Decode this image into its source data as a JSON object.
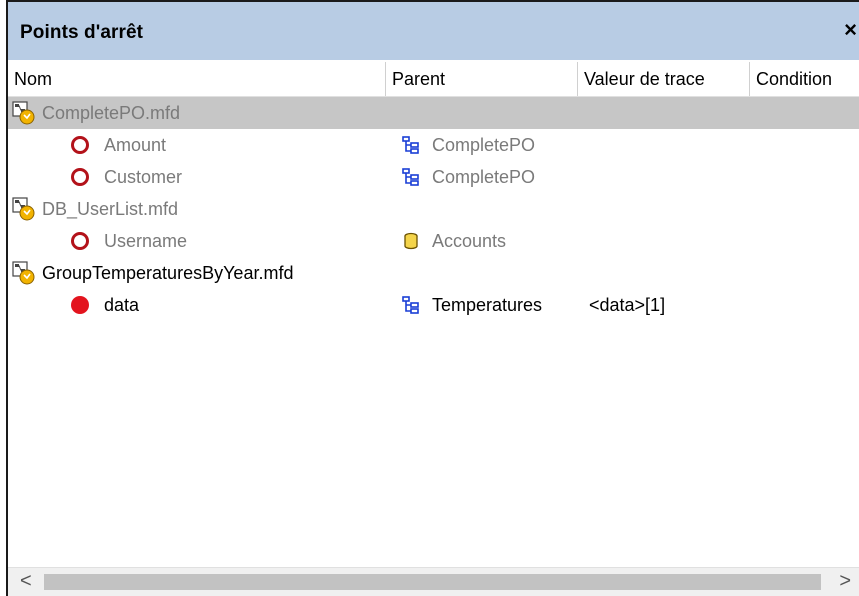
{
  "panel": {
    "title": "Points d'arrêt",
    "close_label": "×"
  },
  "columns": {
    "name": "Nom",
    "parent": "Parent",
    "trace_value": "Valeur de trace",
    "condition": "Condition"
  },
  "rows": [
    {
      "type": "file",
      "name": "CompletePO.mfd",
      "selected": true
    },
    {
      "type": "breakpoint",
      "name": "Amount",
      "parent": "CompletePO",
      "parent_icon": "schema-tree-icon",
      "enabled": false
    },
    {
      "type": "breakpoint",
      "name": "Customer",
      "parent": "CompletePO",
      "parent_icon": "schema-tree-icon",
      "enabled": false
    },
    {
      "type": "file",
      "name": "DB_UserList.mfd"
    },
    {
      "type": "breakpoint",
      "name": "Username",
      "parent": "Accounts",
      "parent_icon": "database-icon",
      "enabled": false
    },
    {
      "type": "file",
      "name": "GroupTemperaturesByYear.mfd"
    },
    {
      "type": "breakpoint",
      "name": "data",
      "parent": "Temperatures",
      "parent_icon": "schema-tree-icon",
      "trace_value": "<data>[1]",
      "enabled": true
    }
  ],
  "scrollbar": {
    "left_arrow": "<",
    "right_arrow": ">"
  },
  "colors": {
    "titlebar": "#b8cce4",
    "selected_row": "#c6c6c6",
    "breakpoint_active": "#e3141e",
    "breakpoint_inactive": "#b3121a",
    "schema_icon": "#1a3fd6"
  }
}
